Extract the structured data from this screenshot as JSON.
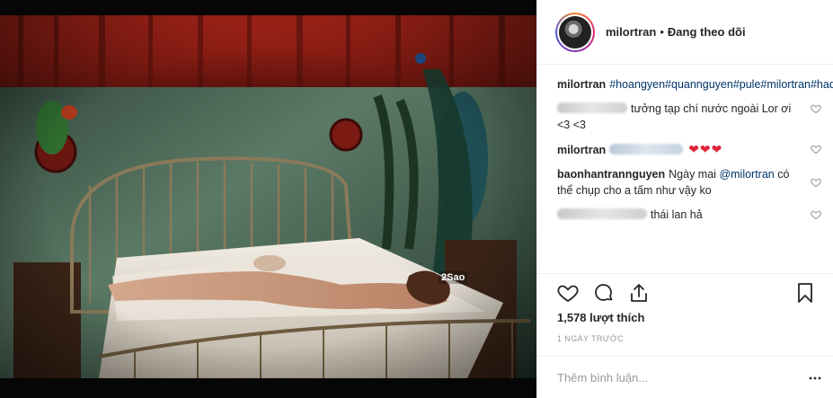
{
  "photo": {
    "watermark": "2Sao",
    "colors": {
      "wall": "#3d5a4a",
      "curtain": "#8a1c14",
      "sheet": "#e8e2d8"
    }
  },
  "header": {
    "username": "milortran",
    "separator": "•",
    "follow_status": "Đang theo dõi"
  },
  "caption": {
    "user": "milortran",
    "hashtags": "#hoangyen#quannguyen#pule#milortran#hado"
  },
  "comments": [
    {
      "user_blurred": true,
      "text": "tưởng tạp chí nước ngoài Lor ơi <3 <3"
    },
    {
      "user": "milortran",
      "mention_blurred": true,
      "hearts": "❤❤❤"
    },
    {
      "user": "baonhantrannguyen",
      "text_before": "Ngày mai",
      "mention": "@milortran",
      "text_after": "có thể chụp cho a tấm như vậy ko"
    },
    {
      "user_blurred": true,
      "text": "thái lan hả"
    }
  ],
  "likes": "1,578 lượt thích",
  "timestamp": "1 ngày trước",
  "comment_input": {
    "placeholder": "Thêm bình luận..."
  },
  "icons": [
    "heart-icon",
    "comment-icon",
    "share-icon",
    "bookmark-icon",
    "more-options-icon"
  ]
}
